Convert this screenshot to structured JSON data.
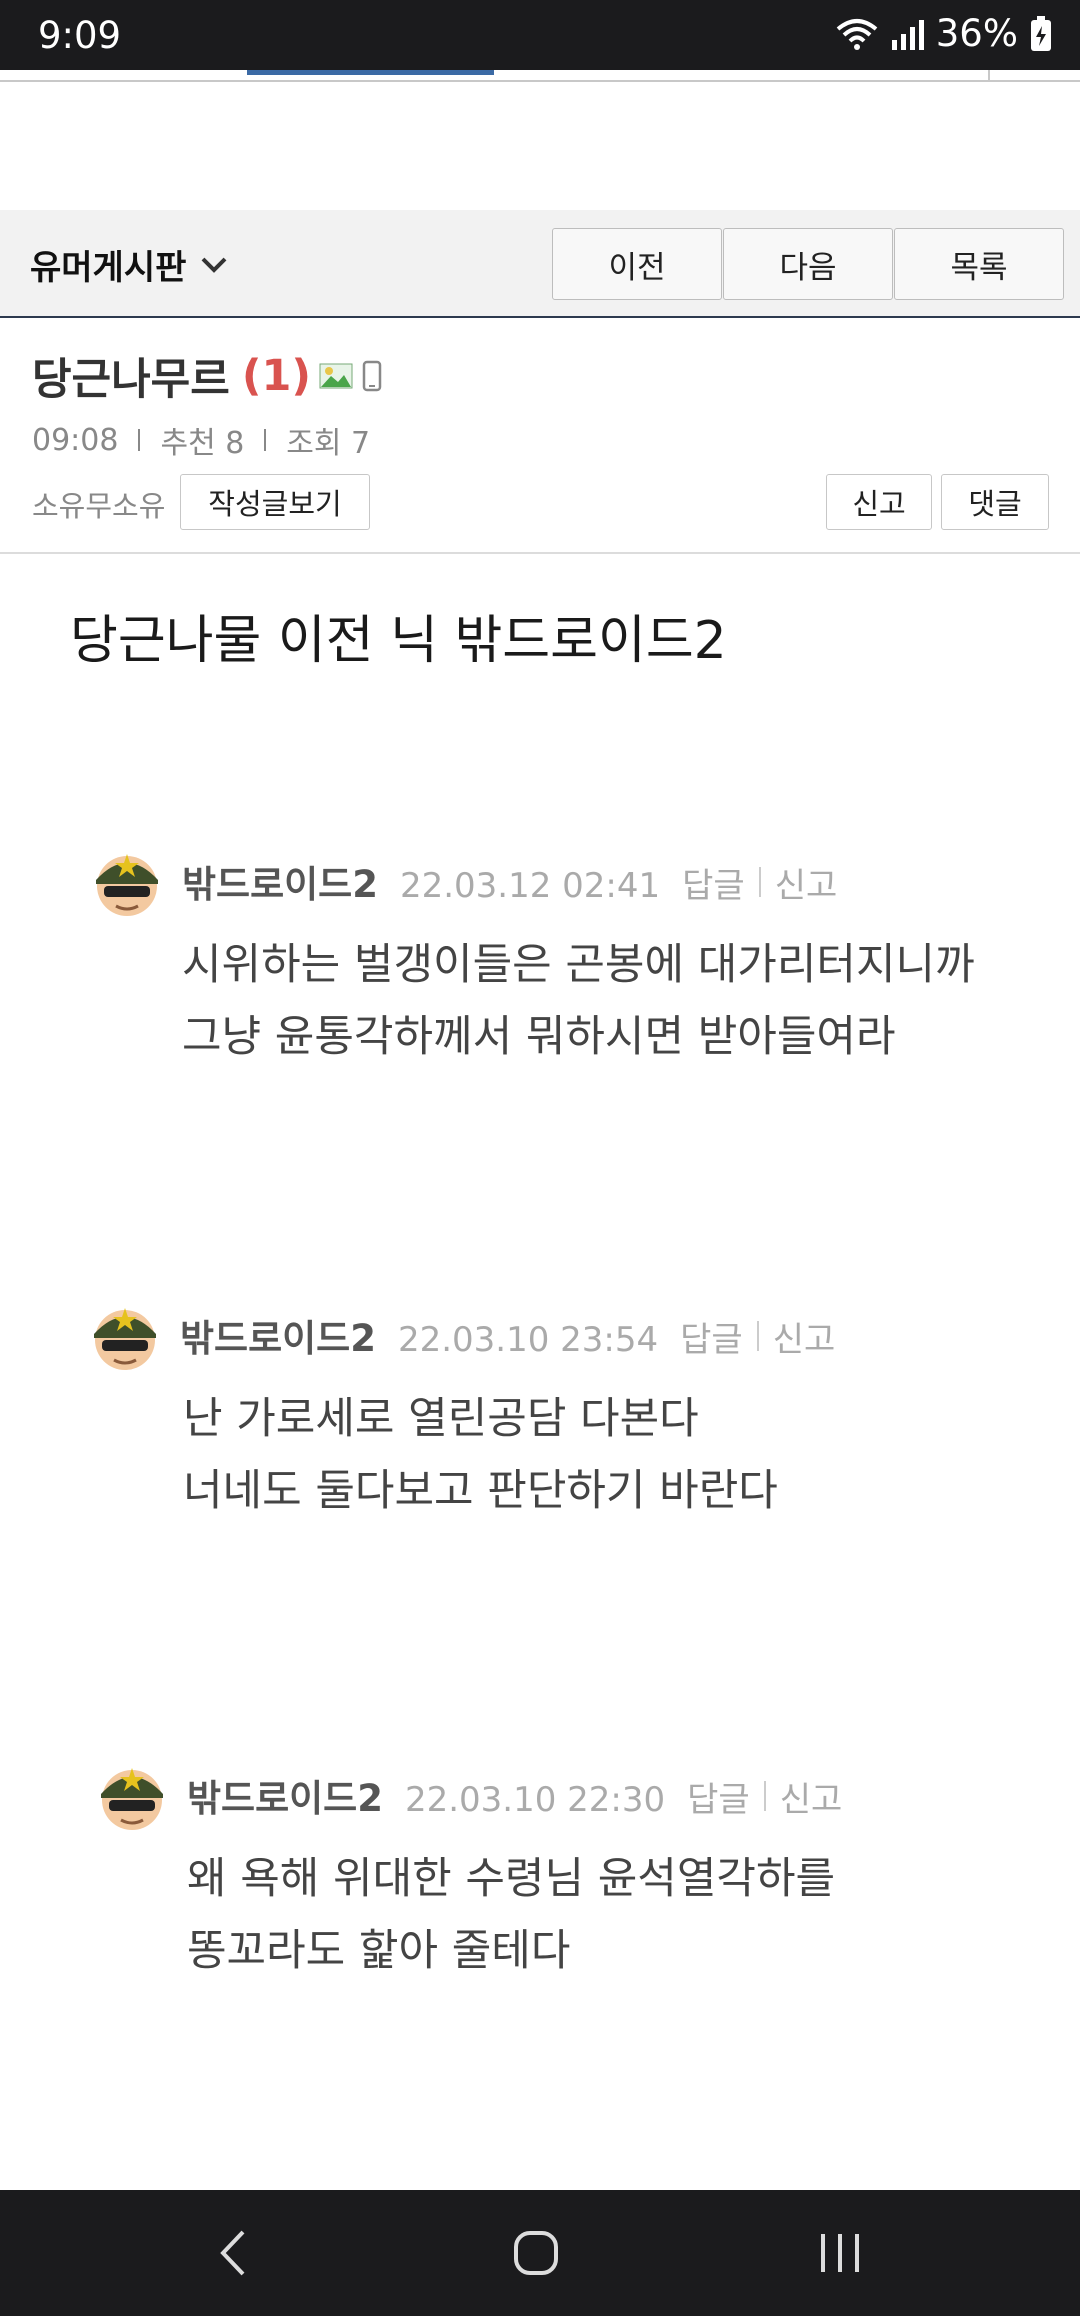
{
  "status": {
    "time": "9:09",
    "battery": "36%"
  },
  "board": {
    "title": "유머게시판",
    "buttons": {
      "prev": "이전",
      "next": "다음",
      "list": "목록"
    }
  },
  "post": {
    "title": "당근나무르",
    "comment_count": "(1)",
    "time": "09:08",
    "recommend": "추천 8",
    "views": "조회 7",
    "author": "소유무소유",
    "view_posts": "작성글보기",
    "report": "신고",
    "comment": "댓글",
    "body": "당근나물 이전 닉 밖드로이드2"
  },
  "comments": [
    {
      "name": "밖드로이드2",
      "date": "22.03.12 02:41",
      "reply": "답글",
      "report": "신고",
      "lines": [
        "시위하는 벌갱이들은 곤봉에 대가리터지니까",
        "그냥 윤통각하께서 뭐하시면 받아들여라"
      ]
    },
    {
      "name": "밖드로이드2",
      "date": "22.03.10 23:54",
      "reply": "답글",
      "report": "신고",
      "lines": [
        "난 가로세로 열린공담 다본다",
        "너네도 둘다보고 판단하기 바란다"
      ]
    },
    {
      "name": "밖드로이드2",
      "date": "22.03.10 22:30",
      "reply": "답글",
      "report": "신고",
      "lines": [
        "왜 욕해 위대한 수령님 윤석열각하를",
        "똥꼬라도 핥아 줄테다"
      ]
    }
  ],
  "icons": {
    "dropdown": "chevron-down-icon",
    "image": "image-icon",
    "mobile": "mobile-icon",
    "avatar": "soldier-avatar",
    "back": "back-icon",
    "home": "home-icon",
    "recents": "recents-icon"
  }
}
